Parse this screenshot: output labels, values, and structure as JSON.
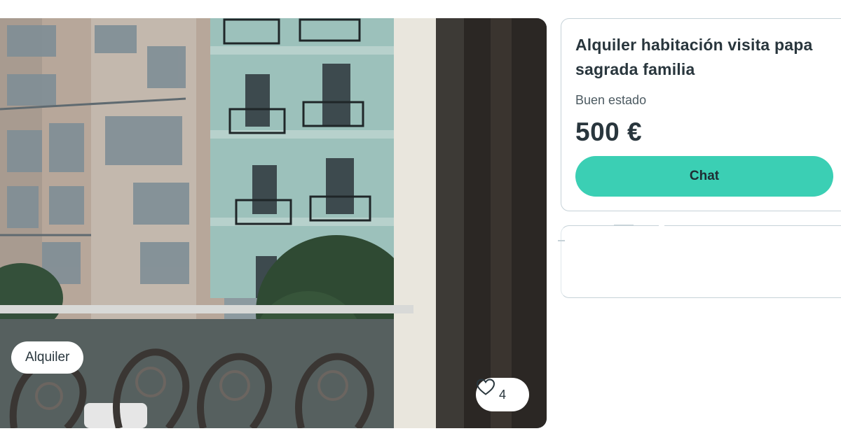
{
  "listing": {
    "badge": "Alquiler",
    "favorites_count": "4",
    "title": "Alquiler habitación visita papa sagrada familia",
    "condition": "Buen estado",
    "price": "500 €",
    "chat_label": "Chat"
  },
  "colors": {
    "accent": "#3bcfb4",
    "text": "#29363d",
    "border": "#c6d2d8"
  },
  "icons": {
    "favorite": "heart-icon"
  }
}
